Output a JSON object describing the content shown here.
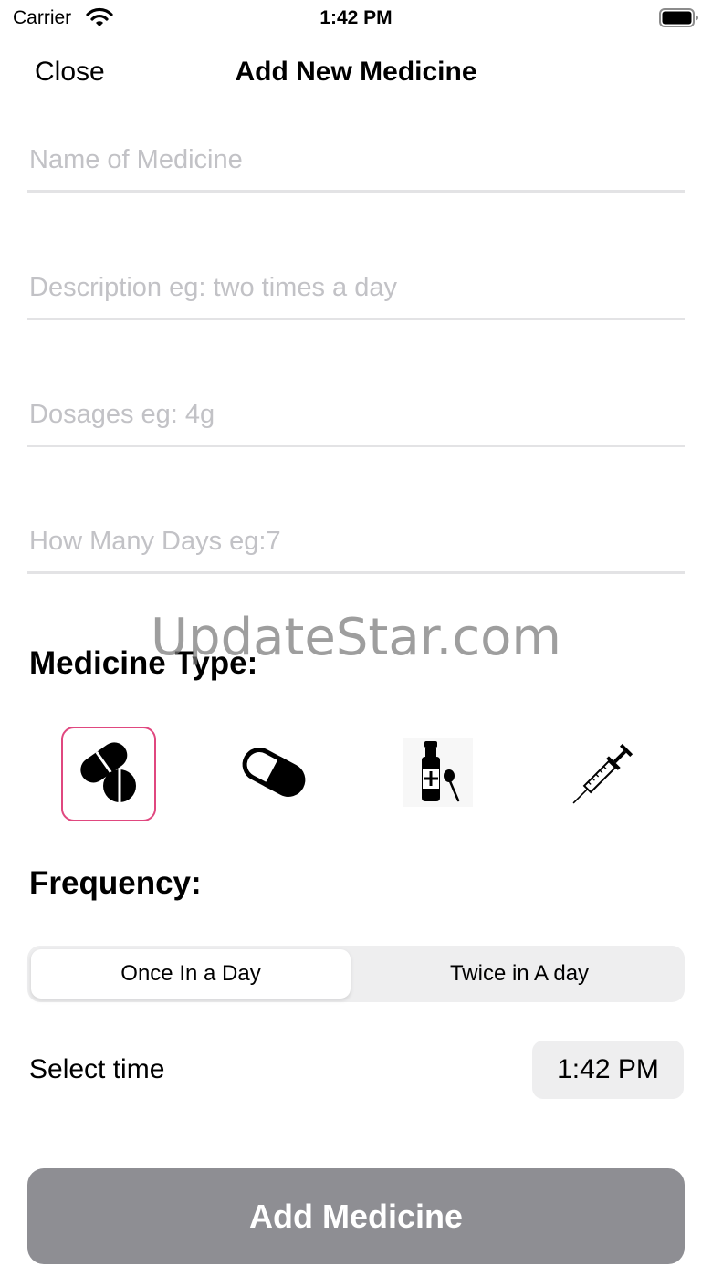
{
  "status_bar": {
    "carrier": "Carrier",
    "time": "1:42 PM"
  },
  "nav": {
    "close_label": "Close",
    "title": "Add New Medicine"
  },
  "fields": {
    "name_placeholder": "Name of Medicine",
    "description_placeholder": "Description eg: two times a day",
    "dosage_placeholder": "Dosages eg: 4g",
    "days_placeholder": "How Many Days eg:7"
  },
  "watermark": "UpdateStar.com",
  "medicine_type": {
    "title": "Medicine Type:",
    "options": [
      {
        "icon": "tablet-icon",
        "selected": true
      },
      {
        "icon": "capsule-icon",
        "selected": false
      },
      {
        "icon": "syrup-bottle-icon",
        "selected": false
      },
      {
        "icon": "syringe-icon",
        "selected": false
      }
    ],
    "selected_color": "#e0477f"
  },
  "frequency": {
    "title": "Frequency:",
    "options": [
      "Once In a Day",
      "Twice in A day"
    ],
    "selected_index": 0
  },
  "time_select": {
    "label": "Select time",
    "value": "1:42 PM"
  },
  "submit": {
    "label": "Add Medicine",
    "color": "#8e8e93"
  }
}
